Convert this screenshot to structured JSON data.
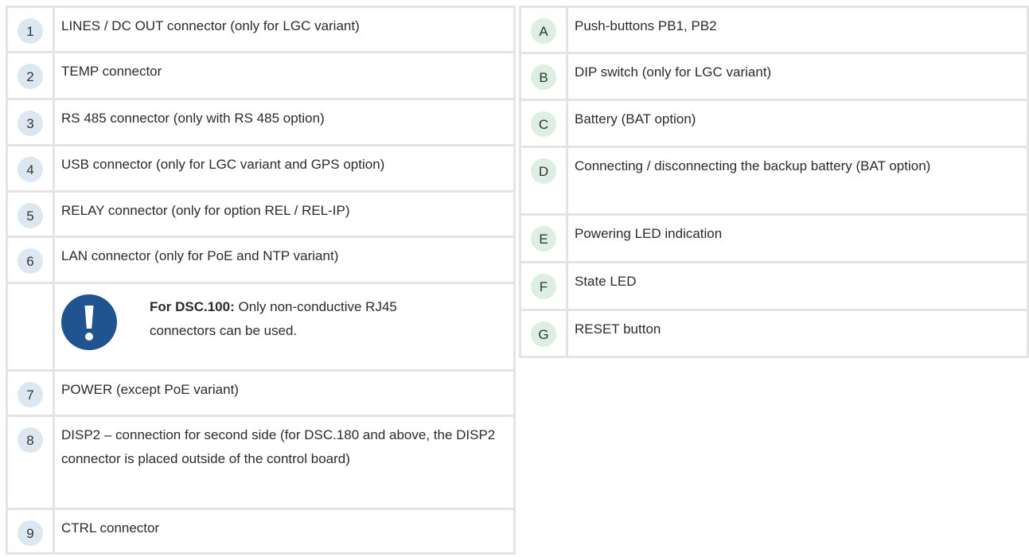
{
  "colors": {
    "border": "#e4e4e4",
    "left_badge_bg": "#dde7f2",
    "right_badge_bg": "#ddeee3",
    "note_icon": "#1f5491"
  },
  "left_items": [
    {
      "num": "1",
      "text": "LINES / DC OUT connector (only for LGC variant)"
    },
    {
      "num": "2",
      "text": "TEMP connector"
    },
    {
      "num": "3",
      "text": "RS 485 connector (only with RS 485 option)"
    },
    {
      "num": "4",
      "text": "USB connector (only for LGC variant and GPS option)"
    },
    {
      "num": "5",
      "text": "RELAY connector (only for option REL / REL-IP)"
    },
    {
      "num": "6",
      "text": "LAN connector (only for PoE and NTP variant)"
    },
    {
      "num": "7",
      "text": "POWER (except PoE variant)"
    },
    {
      "num": "8",
      "text": "DISP2 – connection for second side (for DSC.180 and above, the DISP2 connector is placed outside of the control board)"
    },
    {
      "num": "9",
      "text": "CTRL connector"
    }
  ],
  "note": {
    "icon": "exclamation-icon",
    "bold": "For DSC.100:",
    "text": " Only non-conductive RJ45 connectors can be used."
  },
  "right_items": [
    {
      "letter": "A",
      "text": "Push-buttons PB1, PB2"
    },
    {
      "letter": "B",
      "text": "DIP switch (only for LGC variant)"
    },
    {
      "letter": "C",
      "text": "Battery (BAT option)"
    },
    {
      "letter": "D",
      "text": "Connecting / disconnecting the backup battery (BAT option)"
    },
    {
      "letter": "E",
      "text": "Powering LED indication"
    },
    {
      "letter": "F",
      "text": "State LED"
    },
    {
      "letter": "G",
      "text": "RESET button"
    }
  ]
}
